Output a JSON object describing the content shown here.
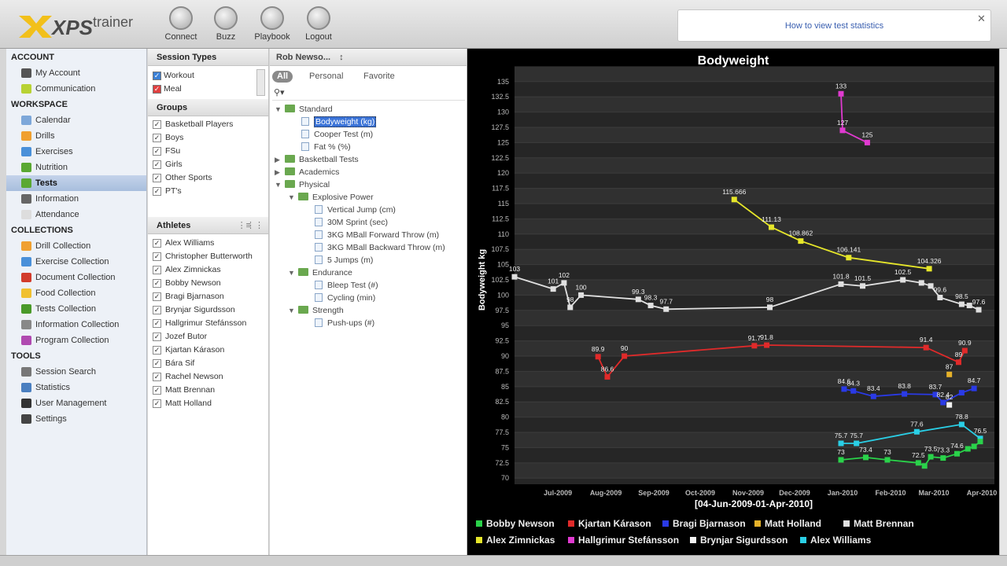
{
  "app": {
    "logo_brand": "XPS",
    "logo_word": "trainer"
  },
  "toolbar": [
    {
      "label": "Connect",
      "icon": "connect-icon"
    },
    {
      "label": "Buzz",
      "icon": "buzz-icon"
    },
    {
      "label": "Playbook",
      "icon": "playbook-icon"
    },
    {
      "label": "Logout",
      "icon": "power-icon"
    }
  ],
  "help_link": "How to view test statistics",
  "sidebar": {
    "sections": [
      {
        "title": "ACCOUNT",
        "items": [
          {
            "label": "My Account",
            "icon": "home-icon",
            "color": "#555555"
          },
          {
            "label": "Communication",
            "icon": "chat-icon",
            "color": "#b8d234"
          }
        ]
      },
      {
        "title": "WORKSPACE",
        "items": [
          {
            "label": "Calendar",
            "icon": "calendar-icon",
            "color": "#7da7d9"
          },
          {
            "label": "Drills",
            "icon": "drills-icon",
            "color": "#f0a030"
          },
          {
            "label": "Exercises",
            "icon": "exercises-icon",
            "color": "#4a90d9"
          },
          {
            "label": "Nutrition",
            "icon": "nutrition-icon",
            "color": "#5aa832"
          },
          {
            "label": "Tests",
            "icon": "tests-icon",
            "color": "#5aa832",
            "selected": true
          },
          {
            "label": "Information",
            "icon": "info-icon",
            "color": "#666666"
          },
          {
            "label": "Attendance",
            "icon": "attendance-icon",
            "color": "#dddddd"
          }
        ]
      },
      {
        "title": "COLLECTIONS",
        "items": [
          {
            "label": "Drill Collection",
            "icon": "folder-orange-icon",
            "color": "#f0a030"
          },
          {
            "label": "Exercise Collection",
            "icon": "folder-blue-icon",
            "color": "#4a90d9"
          },
          {
            "label": "Document Collection",
            "icon": "folder-red-icon",
            "color": "#d23c2c"
          },
          {
            "label": "Food Collection",
            "icon": "folder-yellow-icon",
            "color": "#f0c030"
          },
          {
            "label": "Tests Collection",
            "icon": "folder-green-icon",
            "color": "#4a9a2a"
          },
          {
            "label": "Information Collection",
            "icon": "folder-gray-icon",
            "color": "#888888"
          },
          {
            "label": "Program Collection",
            "icon": "folder-purple-icon",
            "color": "#b04ab0"
          }
        ]
      },
      {
        "title": "TOOLS",
        "items": [
          {
            "label": "Session Search",
            "icon": "search-icon",
            "color": "#777777"
          },
          {
            "label": "Statistics",
            "icon": "statistics-icon",
            "color": "#4a7fc0"
          },
          {
            "label": "User Management",
            "icon": "user-icon",
            "color": "#333333"
          },
          {
            "label": "Settings",
            "icon": "gear-icon",
            "color": "#444444"
          }
        ]
      }
    ]
  },
  "session_types": {
    "title": "Session Types",
    "items": [
      {
        "label": "Workout",
        "color": "#3a7fd5"
      },
      {
        "label": "Meal",
        "color": "#e04040"
      }
    ]
  },
  "groups": {
    "title": "Groups",
    "items": [
      "Basketball Players",
      "Boys",
      "FSu",
      "Girls",
      "Other Sports",
      "PT's"
    ]
  },
  "athletes": {
    "title": "Athletes",
    "items": [
      "Alex Williams",
      "Christopher Butterworth",
      "Alex Zimnickas",
      "Bobby Newson",
      "Bragi Bjarnason",
      "Brynjar Sigurdsson",
      "Hallgrimur Stefánsson",
      "Jozef Butor",
      "Kjartan Kárason",
      "Bára Sif",
      "Rachel Newson",
      "Matt Brennan",
      "Matt Holland"
    ]
  },
  "tests_panel": {
    "user": "Rob Newso...",
    "filters": [
      "All",
      "Personal",
      "Favorite"
    ],
    "active_filter": "All",
    "tree": [
      {
        "label": "Standard",
        "type": "folder",
        "level": 0,
        "open": true
      },
      {
        "label": "Bodyweight (kg)",
        "type": "doc",
        "level": 1,
        "selected": true
      },
      {
        "label": "Cooper Test (m)",
        "type": "doc",
        "level": 1
      },
      {
        "label": "Fat % (%)",
        "type": "doc",
        "level": 1
      },
      {
        "label": "Basketball Tests",
        "type": "folder",
        "level": 0,
        "open": false
      },
      {
        "label": "Academics",
        "type": "folder",
        "level": 0,
        "open": false
      },
      {
        "label": "Physical",
        "type": "folder",
        "level": 0,
        "open": true
      },
      {
        "label": "Explosive Power",
        "type": "folder",
        "level": 1,
        "open": true
      },
      {
        "label": "Vertical Jump (cm)",
        "type": "doc",
        "level": 2
      },
      {
        "label": "30M Sprint (sec)",
        "type": "doc",
        "level": 2
      },
      {
        "label": "3KG MBall Forward Throw (m)",
        "type": "doc",
        "level": 2
      },
      {
        "label": "3KG MBall Backward Throw (m)",
        "type": "doc",
        "level": 2
      },
      {
        "label": "5 Jumps (m)",
        "type": "doc",
        "level": 2
      },
      {
        "label": "Endurance",
        "type": "folder",
        "level": 1,
        "open": true
      },
      {
        "label": "Bleep Test (#)",
        "type": "doc",
        "level": 2
      },
      {
        "label": "Cycling (min)",
        "type": "doc",
        "level": 2
      },
      {
        "label": "Strength",
        "type": "folder",
        "level": 1,
        "open": true
      },
      {
        "label": "Push-ups (#)",
        "type": "doc",
        "level": 2
      }
    ]
  },
  "chart_data": {
    "type": "line",
    "title": "Bodyweight",
    "ylabel": "Bodyweight kg",
    "xlabel": "[04-Jun-2009-01-Apr-2010]",
    "ylim": [
      69,
      136
    ],
    "xlim": [
      "2009-06-04",
      "2010-04-01"
    ],
    "grid": true,
    "legend_position": "bottom",
    "yticks": [
      70,
      72.5,
      75,
      77.5,
      80,
      82.5,
      85,
      87.5,
      90,
      92.5,
      95,
      97.5,
      100,
      102.5,
      105,
      107.5,
      110,
      112.5,
      115,
      117.5,
      120,
      122.5,
      125,
      127.5,
      130,
      132.5,
      135
    ],
    "xticks": [
      {
        "date": "2009-07-01",
        "label": "Jul-2009"
      },
      {
        "date": "2009-08-01",
        "label": "Aug-2009"
      },
      {
        "date": "2009-09-01",
        "label": "Sep-2009"
      },
      {
        "date": "2009-10-01",
        "label": "Oct-2009"
      },
      {
        "date": "2009-11-01",
        "label": "Nov-2009"
      },
      {
        "date": "2009-12-01",
        "label": "Dec-2009"
      },
      {
        "date": "2010-01-01",
        "label": "Jan-2010"
      },
      {
        "date": "2010-02-01",
        "label": "Feb-2010"
      },
      {
        "date": "2010-03-01",
        "label": "Mar-2010"
      },
      {
        "date": "2010-04-01",
        "label": "Apr-2010"
      }
    ],
    "series": [
      {
        "name": "Matt Brennan",
        "color": "#e0e0e0",
        "points": [
          {
            "x": "2009-06-04",
            "y": 103,
            "label": "103"
          },
          {
            "x": "2009-06-29",
            "y": 101,
            "label": "101"
          },
          {
            "x": "2009-07-06",
            "y": 102,
            "label": "102"
          },
          {
            "x": "2009-07-10",
            "y": 98,
            "label": "98"
          },
          {
            "x": "2009-07-17",
            "y": 100,
            "label": "100"
          },
          {
            "x": "2009-08-23",
            "y": 99.3,
            "label": "99.3"
          },
          {
            "x": "2009-08-31",
            "y": 98.3,
            "label": "98.3"
          },
          {
            "x": "2009-09-10",
            "y": 97.7,
            "label": "97.7"
          },
          {
            "x": "2009-11-16",
            "y": 98,
            "label": "98"
          },
          {
            "x": "2010-01-01",
            "y": 101.8,
            "label": "101.8"
          },
          {
            "x": "2010-01-15",
            "y": 101.5,
            "label": "101.5"
          },
          {
            "x": "2010-02-10",
            "y": 102.5,
            "label": "102.5"
          },
          {
            "x": "2010-02-22",
            "y": 102,
            "label": ""
          },
          {
            "x": "2010-02-28",
            "y": 101.5,
            "label": ""
          },
          {
            "x": "2010-03-06",
            "y": 99.6,
            "label": "99.6"
          },
          {
            "x": "2010-03-20",
            "y": 98.5,
            "label": "98.5"
          },
          {
            "x": "2010-03-25",
            "y": 98.3,
            "label": ""
          },
          {
            "x": "2010-03-31",
            "y": 97.6,
            "label": "97.6"
          }
        ]
      },
      {
        "name": "Hallgrimur Stefánsson",
        "color": "#e03ad0",
        "points": [
          {
            "x": "2010-01-01",
            "y": 133,
            "label": "133"
          },
          {
            "x": "2010-01-02",
            "y": 127,
            "label": "127"
          },
          {
            "x": "2010-01-18",
            "y": 125,
            "label": "125"
          }
        ]
      },
      {
        "name": "Alex Zimnickas",
        "color": "#e6e62a",
        "points": [
          {
            "x": "2009-10-24",
            "y": 115.666,
            "label": "115.666"
          },
          {
            "x": "2009-11-17",
            "y": 111.13,
            "label": "111.13"
          },
          {
            "x": "2009-12-06",
            "y": 108.862,
            "label": "108.862"
          },
          {
            "x": "2010-01-06",
            "y": 106.141,
            "label": "106.141"
          },
          {
            "x": "2010-02-27",
            "y": 104.326,
            "label": "104.326"
          }
        ]
      },
      {
        "name": "Kjartan Kárason",
        "color": "#e02a2a",
        "points": [
          {
            "x": "2009-07-28",
            "y": 89.9,
            "label": "89.9"
          },
          {
            "x": "2009-08-03",
            "y": 86.6,
            "label": "86.6"
          },
          {
            "x": "2009-08-14",
            "y": 90,
            "label": "90"
          },
          {
            "x": "2009-11-06",
            "y": 91.7,
            "label": "91.7"
          },
          {
            "x": "2009-11-14",
            "y": 91.8,
            "label": "91.8"
          },
          {
            "x": "2010-02-25",
            "y": 91.4,
            "label": "91.4"
          },
          {
            "x": "2010-03-18",
            "y": 89,
            "label": "89"
          },
          {
            "x": "2010-03-22",
            "y": 90.9,
            "label": "90.9"
          }
        ]
      },
      {
        "name": "Bragi Bjarnason",
        "color": "#2a3ae6",
        "points": [
          {
            "x": "2010-01-03",
            "y": 84.6,
            "label": "84.6"
          },
          {
            "x": "2010-01-09",
            "y": 84.3,
            "label": "84.3"
          },
          {
            "x": "2010-01-22",
            "y": 83.4,
            "label": "83.4"
          },
          {
            "x": "2010-02-11",
            "y": 83.8,
            "label": "83.8"
          },
          {
            "x": "2010-03-03",
            "y": 83.7,
            "label": "83.7"
          },
          {
            "x": "2010-03-08",
            "y": 82.4,
            "label": "82.4"
          },
          {
            "x": "2010-03-20",
            "y": 84,
            "label": ""
          },
          {
            "x": "2010-03-28",
            "y": 84.7,
            "label": "84.7"
          }
        ]
      },
      {
        "name": "Matt Holland",
        "color": "#e6b22a",
        "points": [
          {
            "x": "2010-03-12",
            "y": 87,
            "label": "87"
          }
        ]
      },
      {
        "name": "Brynjar Sigurdsson",
        "color": "#f2f2f2",
        "points": [
          {
            "x": "2010-03-12",
            "y": 82,
            "label": "82"
          }
        ]
      },
      {
        "name": "Alex Williams",
        "color": "#2acfe6",
        "points": [
          {
            "x": "2010-01-01",
            "y": 75.7,
            "label": "75.7"
          },
          {
            "x": "2010-01-11",
            "y": 75.7,
            "label": "75.7"
          },
          {
            "x": "2010-02-19",
            "y": 77.6,
            "label": "77.6"
          },
          {
            "x": "2010-03-20",
            "y": 78.8,
            "label": "78.8"
          },
          {
            "x": "2010-04-01",
            "y": 76.5,
            "label": "76.5"
          }
        ]
      },
      {
        "name": "Bobby Newson",
        "color": "#2ad24a",
        "points": [
          {
            "x": "2010-01-01",
            "y": 73,
            "label": "73"
          },
          {
            "x": "2010-01-17",
            "y": 73.4,
            "label": "73.4"
          },
          {
            "x": "2010-01-31",
            "y": 73,
            "label": "73"
          },
          {
            "x": "2010-02-20",
            "y": 72.5,
            "label": "72.5"
          },
          {
            "x": "2010-02-24",
            "y": 72,
            "label": ""
          },
          {
            "x": "2010-02-28",
            "y": 73.5,
            "label": "73.5"
          },
          {
            "x": "2010-03-08",
            "y": 73.3,
            "label": "73.3"
          },
          {
            "x": "2010-03-17",
            "y": 74,
            "label": "74.6"
          },
          {
            "x": "2010-03-24",
            "y": 74.8,
            "label": ""
          },
          {
            "x": "2010-03-28",
            "y": 75.2,
            "label": ""
          },
          {
            "x": "2010-04-01",
            "y": 76,
            "label": ""
          }
        ]
      }
    ],
    "legend": [
      {
        "name": "Bobby Newson",
        "color": "#2ad24a"
      },
      {
        "name": "Kjartan Kárason",
        "color": "#e02a2a"
      },
      {
        "name": "Bragi Bjarnason",
        "color": "#2a3ae6"
      },
      {
        "name": "Matt Holland",
        "color": "#e6b22a"
      },
      {
        "name": "Matt Brennan",
        "color": "#e0e0e0"
      },
      {
        "name": "Alex Zimnickas",
        "color": "#e6e62a"
      },
      {
        "name": "Hallgrimur Stefánsson",
        "color": "#e03ad0"
      },
      {
        "name": "Brynjar Sigurdsson",
        "color": "#f2f2f2"
      },
      {
        "name": "Alex Williams",
        "color": "#2acfe6"
      }
    ]
  }
}
